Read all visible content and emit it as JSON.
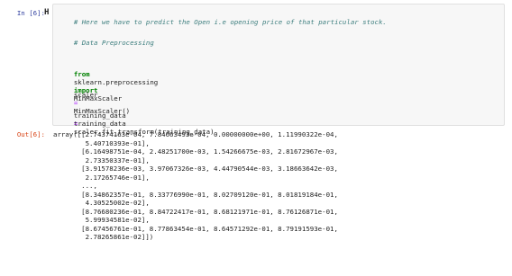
{
  "input_cell": {
    "prompt": "In [6]:",
    "run_icon": "H",
    "lines": [
      {
        "type": "comment",
        "text": "# Here we have to predict the Open i.e opening price of that particular stock."
      },
      {
        "type": "comment",
        "text": "# Data Preprocessing"
      },
      {
        "type": "import",
        "kw1": "from",
        "module": "sklearn.preprocessing",
        "kw2": "import",
        "name": "MinMaxScaler"
      },
      {
        "type": "assign",
        "lhs": "scaler",
        "op": "=",
        "rhs": "MinMaxScaler()"
      },
      {
        "type": "assign",
        "lhs": "training_data",
        "op": "=",
        "rhs": "scaler.fit_transform(training_data)"
      },
      {
        "type": "plain",
        "text": "training_data"
      }
    ]
  },
  "output_cell": {
    "prompt": "Out[6]:",
    "lines": [
      "array([[2.74374163e-04, 7.84663493e-04, 0.00000000e+00, 1.11990322e-04,",
      "        5.40710393e-01],",
      "       [6.16498751e-04, 2.48251700e-03, 1.54266675e-03, 2.81672967e-03,",
      "        2.73350337e-01],",
      "       [3.91578236e-03, 3.97067326e-03, 4.44790544e-03, 3.18663642e-03,",
      "        2.17265746e-01],",
      "       ...,",
      "       [8.34862357e-01, 8.33776990e-01, 8.02709120e-01, 8.01819184e-01,",
      "        4.30525002e-02],",
      "       [8.76680236e-01, 8.84722417e-01, 8.68121971e-01, 8.76126871e-01,",
      "        5.99934581e-02],",
      "       [8.67456761e-01, 8.77863454e-01, 8.64571292e-01, 8.79191593e-01,",
      "        2.78265861e-02]])"
    ]
  }
}
